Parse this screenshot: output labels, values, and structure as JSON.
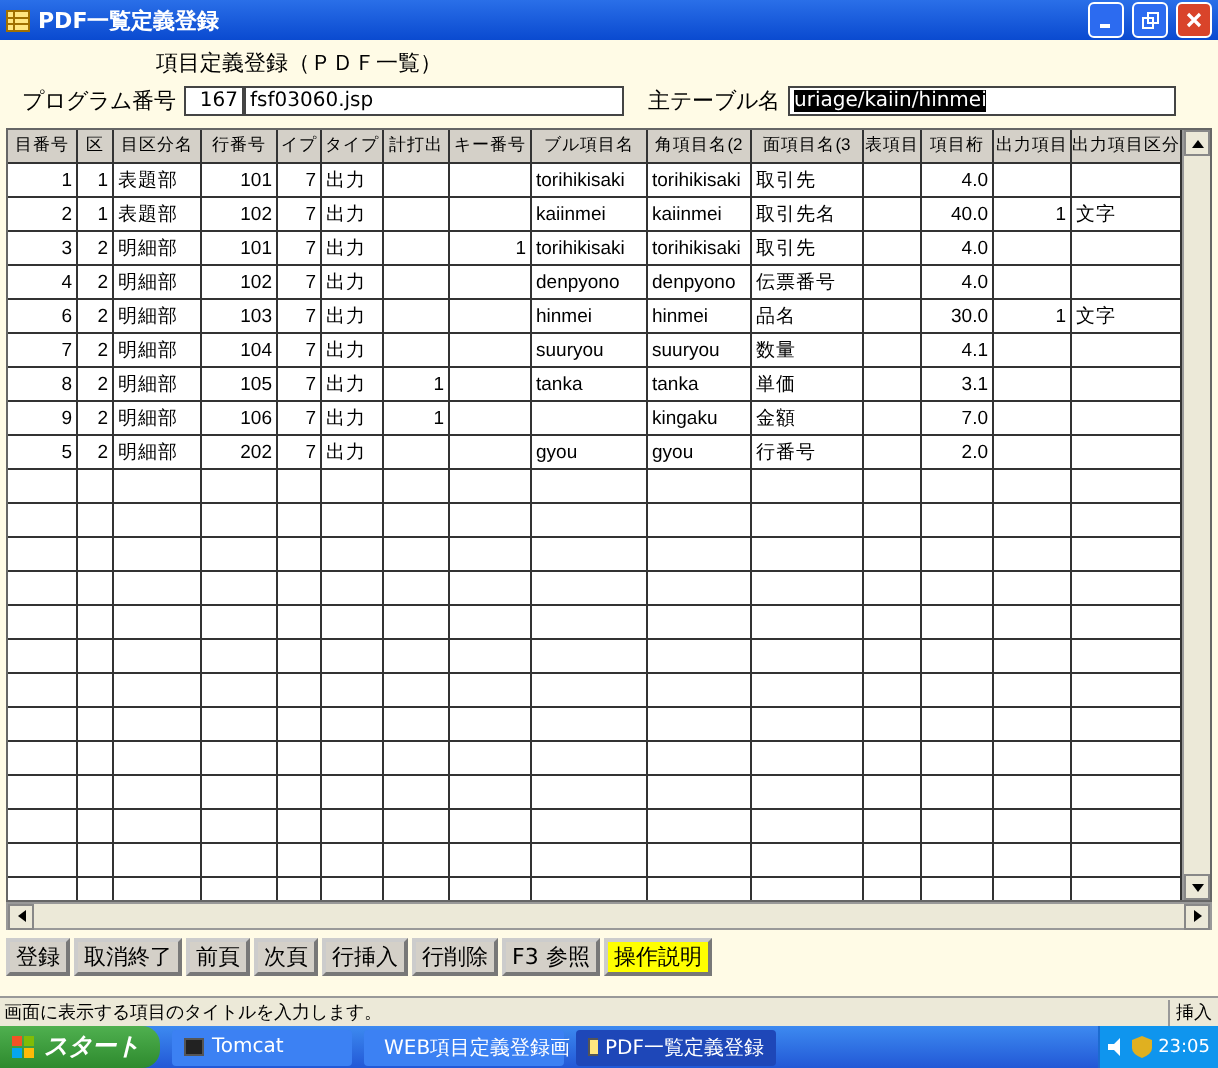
{
  "window": {
    "title": "PDF一覧定義登録"
  },
  "form": {
    "heading": "項目定義登録（ＰＤＦ一覧）",
    "program_label": "プログラム番号",
    "program_number": "167",
    "program_file": "fsf03060.jsp",
    "table_label": "主テーブル名",
    "table_value": "uriage/kaiin/hinmei"
  },
  "table": {
    "columns": [
      {
        "label": "目番号",
        "kind": "number"
      },
      {
        "label": "区",
        "kind": "number"
      },
      {
        "label": "目区分名",
        "kind": "text"
      },
      {
        "label": "行番号",
        "kind": "number"
      },
      {
        "label": "イプ",
        "kind": "number"
      },
      {
        "label": "タイプ",
        "kind": "text"
      },
      {
        "label": "計打出",
        "kind": "number"
      },
      {
        "label": "キー番号",
        "kind": "number"
      },
      {
        "label": "ブル項目名",
        "kind": "text"
      },
      {
        "label": "角項目名(2",
        "kind": "text"
      },
      {
        "label": "面項目名(3",
        "kind": "text"
      },
      {
        "label": "表項目"
      },
      {
        "label": "項目桁",
        "kind": "number"
      },
      {
        "label": "出力項目",
        "kind": "number"
      },
      {
        "label": "出力項目区分",
        "kind": "text"
      }
    ],
    "rows": [
      [
        "1",
        "1",
        "表題部",
        "101",
        "7",
        "出力",
        "",
        "",
        "torihikisaki",
        "torihikisaki",
        "取引先",
        "",
        "4.0",
        "",
        ""
      ],
      [
        "2",
        "1",
        "表題部",
        "102",
        "7",
        "出力",
        "",
        "",
        "kaiinmei",
        "kaiinmei",
        "取引先名",
        "",
        "40.0",
        "1",
        "文字"
      ],
      [
        "3",
        "2",
        "明細部",
        "101",
        "7",
        "出力",
        "",
        "1",
        "torihikisaki",
        "torihikisaki",
        "取引先",
        "",
        "4.0",
        "",
        ""
      ],
      [
        "4",
        "2",
        "明細部",
        "102",
        "7",
        "出力",
        "",
        "",
        "denpyono",
        "denpyono",
        "伝票番号",
        "",
        "4.0",
        "",
        ""
      ],
      [
        "6",
        "2",
        "明細部",
        "103",
        "7",
        "出力",
        "",
        "",
        "hinmei",
        "hinmei",
        "品名",
        "",
        "30.0",
        "1",
        "文字"
      ],
      [
        "7",
        "2",
        "明細部",
        "104",
        "7",
        "出力",
        "",
        "",
        "suuryou",
        "suuryou",
        "数量",
        "",
        "4.1",
        "",
        ""
      ],
      [
        "8",
        "2",
        "明細部",
        "105",
        "7",
        "出力",
        "1",
        "",
        "tanka",
        "tanka",
        "単価",
        "",
        "3.1",
        "",
        ""
      ],
      [
        "9",
        "2",
        "明細部",
        "106",
        "7",
        "出力",
        "1",
        "",
        "",
        "kingaku",
        "金額",
        "",
        "7.0",
        "",
        ""
      ],
      [
        "5",
        "2",
        "明細部",
        "202",
        "7",
        "出力",
        "",
        "",
        "gyou",
        "gyou",
        "行番号",
        "",
        "2.0",
        "",
        ""
      ]
    ]
  },
  "buttons": [
    {
      "label": "登録",
      "highlighted": false
    },
    {
      "label": "取消終了",
      "highlighted": false
    },
    {
      "label": "前頁",
      "highlighted": false
    },
    {
      "label": "次頁",
      "highlighted": false
    },
    {
      "label": "行挿入",
      "highlighted": false
    },
    {
      "label": "行削除",
      "highlighted": false
    },
    {
      "label": "F3 参照",
      "highlighted": false
    },
    {
      "label": "操作説明",
      "highlighted": true
    }
  ],
  "status_bar": {
    "message": "画面に表示する項目のタイトルを入力します。",
    "mode": "挿入"
  },
  "taskbar": {
    "start": "スタート",
    "tasks": [
      {
        "label": "Tomcat",
        "selected": false
      },
      {
        "label": "WEB項目定義登録画",
        "selected": false
      },
      {
        "label": "PDF一覧定義登録",
        "selected": true
      }
    ],
    "clock": "23:05"
  }
}
